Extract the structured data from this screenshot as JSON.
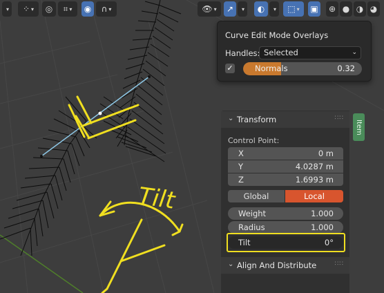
{
  "header": {
    "icons": [
      "transform-pivot-icon",
      "snap-icon",
      "snap-increment-icon",
      "proportional-edit-icon",
      "falloff-icon",
      "visibility-icon",
      "gizmo-icon",
      "overlays-icon",
      "xray-icon",
      "shading-wireframe-icon",
      "shading-solid-icon",
      "shading-material-icon",
      "shading-rendered-icon"
    ]
  },
  "overlay_popover": {
    "title": "Curve Edit Mode Overlays",
    "handles_label": "Handles:",
    "handles_value": "Selected",
    "normals_checked": true,
    "normals_label": "Normals",
    "normals_value": "0.32",
    "normals_fraction": 0.32,
    "slider_color": "#c9792e"
  },
  "sidebar": {
    "tab_label": "Item",
    "transform": {
      "title": "Transform",
      "control_point_label": "Control Point:",
      "x_label": "X",
      "x_value": "0 m",
      "y_label": "Y",
      "y_value": "4.0287 m",
      "z_label": "Z",
      "z_value": "1.6993 m",
      "global_label": "Global",
      "local_label": "Local",
      "weight_label": "Weight",
      "weight_value": "1.000",
      "radius_label": "Radius",
      "radius_value": "1.000",
      "tilt_label": "Tilt",
      "tilt_value": "0°"
    },
    "align_panel_title": "Align And Distribute"
  },
  "annotation": {
    "text": "Tilt",
    "color": "#f0df20"
  },
  "colors": {
    "viewport_bg": "#3d3d3d",
    "active_blue": "#4772b3",
    "local_active": "#d8552e",
    "tab_green": "#4a8c5a"
  }
}
